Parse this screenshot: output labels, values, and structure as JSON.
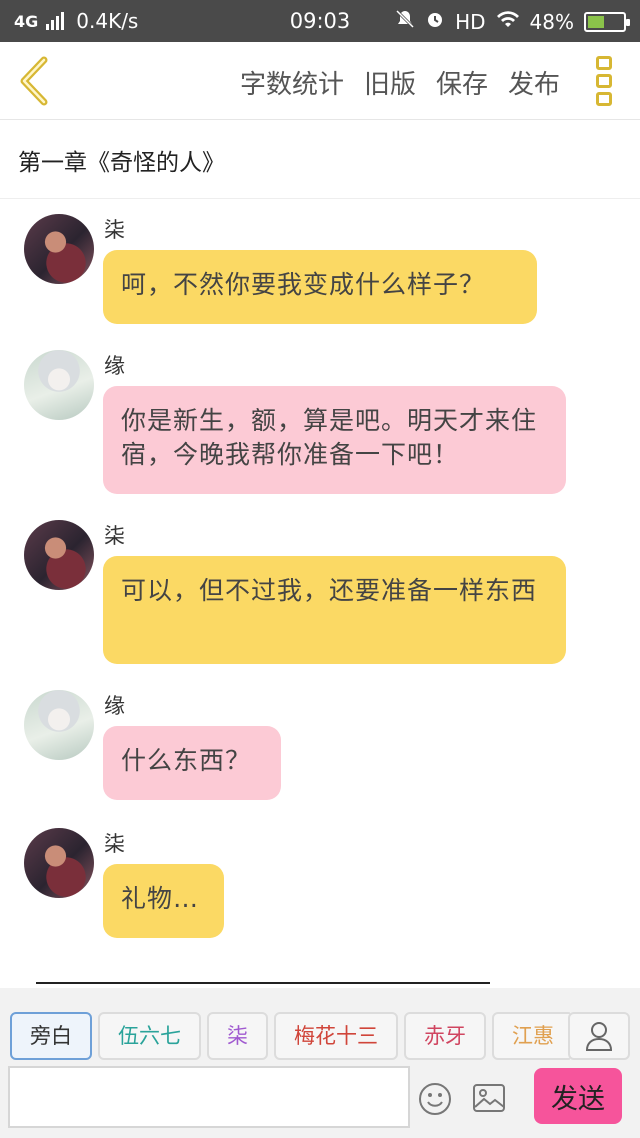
{
  "status_bar": {
    "network": "4G",
    "speed": "0.4K/s",
    "time": "09:03",
    "hd_label": "HD",
    "battery": "48%",
    "battery_level": 0.48
  },
  "header": {
    "actions": [
      "字数统计",
      "旧版",
      "保存",
      "发布"
    ],
    "accent_color": "#d7b733"
  },
  "chapter": {
    "title": "第一章《奇怪的人》"
  },
  "messages": [
    {
      "sender": "柒",
      "text": "呵，不然你要我变成什么样子？",
      "bubble_color": "#fbd964"
    },
    {
      "sender": "缘",
      "text": "你是新生，额，算是吧。明天才来住宿，今晚我帮你准备一下吧！",
      "bubble_color": "#fccad5"
    },
    {
      "sender": "柒",
      "text": "可以，但不过我，还要准备一样东西",
      "bubble_color": "#fbd964"
    },
    {
      "sender": "缘",
      "text": "什么东西？",
      "bubble_color": "#fccad5"
    },
    {
      "sender": "柒",
      "text": "礼物…",
      "bubble_color": "#fbd964"
    }
  ],
  "role_chips": [
    {
      "label": "旁白",
      "color": "#333333"
    },
    {
      "label": "伍六七",
      "color": "#2aa39a"
    },
    {
      "label": "柒",
      "color": "#a05ad0"
    },
    {
      "label": "梅花十三",
      "color": "#d0453a"
    },
    {
      "label": "赤牙",
      "color": "#d04560"
    },
    {
      "label": "江惠",
      "color": "#e0a050"
    }
  ],
  "composer": {
    "input_value": "",
    "send_label": "发送",
    "send_color": "#f6549b"
  }
}
